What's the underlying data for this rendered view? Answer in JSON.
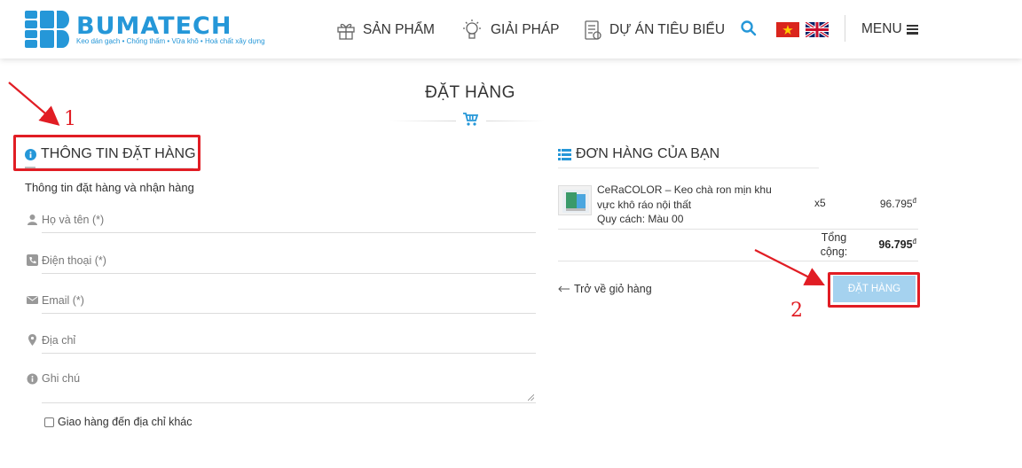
{
  "header": {
    "logo_text": "BUMATECH",
    "logo_tagline": "Keo dán gạch • Chống thấm • Vữa khô • Hoá chất xây dựng",
    "nav": [
      {
        "label": "SẢN PHẨM",
        "icon": "gift-box-icon"
      },
      {
        "label": "GIẢI PHÁP",
        "icon": "lightbulb-icon"
      },
      {
        "label": "DỰ ÁN TIÊU BIỂU",
        "icon": "document-icon"
      }
    ],
    "search_icon": "search-icon",
    "languages": [
      "vietnam-flag-icon",
      "uk-flag-icon"
    ],
    "menu_label": "MENU",
    "brand_color": "#2597d8"
  },
  "page": {
    "title": "ĐẶT HÀNG"
  },
  "order_info": {
    "title": "THÔNG TIN ĐẶT HÀNG",
    "subtitle": "Thông tin đặt hàng và nhận hàng",
    "fields": {
      "name_placeholder": "Họ và tên (*)",
      "phone_placeholder": "Điện thoại (*)",
      "email_placeholder": "Email (*)",
      "address_placeholder": "Địa chỉ",
      "note_placeholder": "Ghi chú"
    },
    "ship_other_label": "Giao hàng đến địa chỉ khác"
  },
  "your_order": {
    "title": "ĐƠN HÀNG CỦA BẠN",
    "items": [
      {
        "name": "CeRaCOLOR – Keo chà ron mịn khu vực khô ráo nội thất",
        "spec": "Quy cách: Màu 00",
        "qty": "x5",
        "price": "96.795",
        "currency": "đ"
      }
    ],
    "total_label": "Tổng cộng:",
    "total_value": "96.795",
    "currency": "đ",
    "back_link": "Trở về giỏ hàng",
    "order_button": "ĐẶT HÀNG",
    "button_color": "#a5d2ef"
  },
  "annotations": {
    "step1": "1",
    "step2": "2",
    "color": "#e11d24"
  }
}
